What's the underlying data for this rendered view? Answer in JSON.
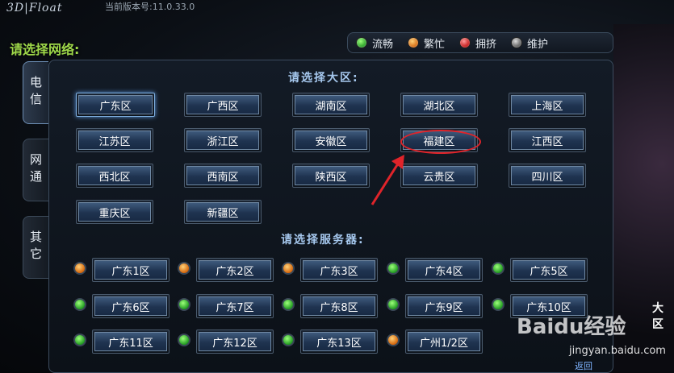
{
  "app": {
    "logo_text": "3D|Float",
    "version": "当前版本号:11.0.33.0"
  },
  "network": {
    "title": "请选择网络:"
  },
  "legend": [
    {
      "label": "流畅",
      "color": "green"
    },
    {
      "label": "繁忙",
      "color": "orange"
    },
    {
      "label": "拥挤",
      "color": "red"
    },
    {
      "label": "维护",
      "color": "gray"
    }
  ],
  "side_tabs": [
    {
      "label": "电信",
      "active": true
    },
    {
      "label": "网通",
      "active": false
    },
    {
      "label": "其它",
      "active": false
    }
  ],
  "regions": {
    "title": "请选择大区:",
    "items": [
      "广东区",
      "广西区",
      "湖南区",
      "湖北区",
      "上海区",
      "江苏区",
      "浙江区",
      "安徽区",
      "福建区",
      "江西区",
      "西北区",
      "西南区",
      "陕西区",
      "云贵区",
      "四川区",
      "重庆区",
      "新疆区"
    ],
    "selected": "广东区",
    "highlighted": "福建区"
  },
  "servers": {
    "title": "请选择服务器:",
    "items": [
      {
        "name": "广东1区",
        "status": "orange"
      },
      {
        "name": "广东2区",
        "status": "orange"
      },
      {
        "name": "广东3区",
        "status": "orange"
      },
      {
        "name": "广东4区",
        "status": "green"
      },
      {
        "name": "广东5区",
        "status": "green"
      },
      {
        "name": "广东6区",
        "status": "green"
      },
      {
        "name": "广东7区",
        "status": "green"
      },
      {
        "name": "广东8区",
        "status": "green"
      },
      {
        "name": "广东9区",
        "status": "green"
      },
      {
        "name": "广东10区",
        "status": "green"
      },
      {
        "name": "广东11区",
        "status": "green"
      },
      {
        "name": "广东12区",
        "status": "green"
      },
      {
        "name": "广东13区",
        "status": "green"
      },
      {
        "name": "广州1/2区",
        "status": "orange"
      }
    ]
  },
  "right_panel": {
    "label": "大区"
  },
  "back_button": {
    "label": "返回"
  },
  "watermark": {
    "brand": "Baidu经验",
    "url": "jingyan.baidu.com"
  },
  "colors": {
    "accent": "#9ed84a",
    "highlight": "#e0242a",
    "title_blue": "#a6c8ee"
  }
}
